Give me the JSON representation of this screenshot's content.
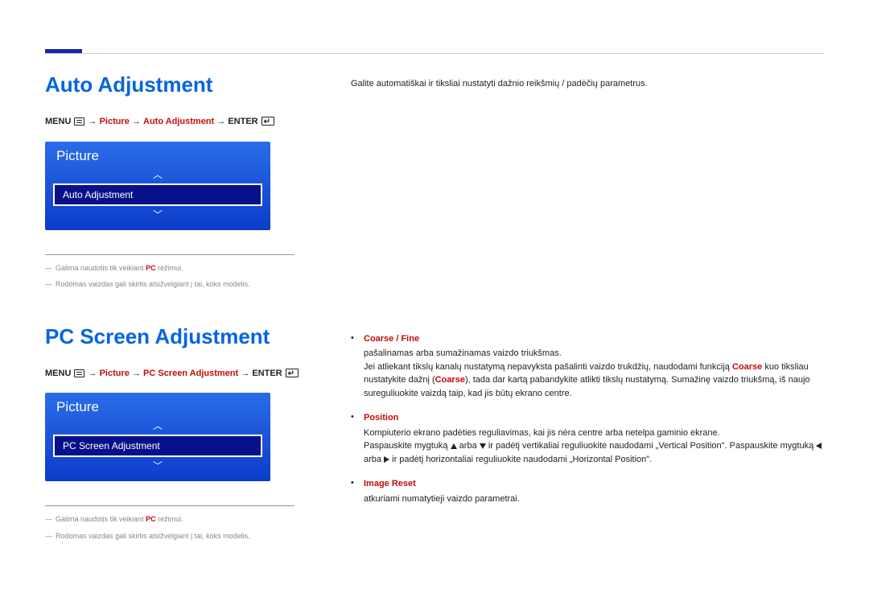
{
  "section1": {
    "title": "Auto Adjustment",
    "path": {
      "menu": "MENU",
      "p1": "Picture",
      "p2": "Auto Adjustment",
      "enter": "ENTER"
    },
    "osd": {
      "title": "Picture",
      "item": "Auto Adjustment"
    },
    "notes": {
      "n1_pre": "Galima naudotis tik veikiant ",
      "n1_hl": "PC",
      "n1_post": " režimui.",
      "n2": "Rodomas vaizdas gali skirtis atsižvelgiant į tai, koks modelis."
    },
    "desc": "Galite automatiškai ir tiksliai nustatyti dažnio reikšmių / padėčių parametrus."
  },
  "section2": {
    "title": "PC Screen Adjustment",
    "path": {
      "menu": "MENU",
      "p1": "Picture",
      "p2": "PC Screen Adjustment",
      "enter": "ENTER"
    },
    "osd": {
      "title": "Picture",
      "item": "PC Screen Adjustment"
    },
    "notes": {
      "n1_pre": "Galima naudotis tik veikiant ",
      "n1_hl": "PC",
      "n1_post": " režimui.",
      "n2": "Rodomas vaizdas gali skirtis atsižvelgiant į tai, koks modelis."
    },
    "bullets": {
      "b1": {
        "title": "Coarse / Fine",
        "l1": "pašalinamas arba sumažinamas vaizdo triukšmas.",
        "l2a": "Jei atliekant tikslų kanalų nustatymą nepavyksta pašalinti vaizdo trukdžių, naudodami funkciją ",
        "l2hl1": "Coarse",
        "l2b": " kuo tiksliau nustatykite dažnį (",
        "l2hl2": "Coarse",
        "l2c": "), tada dar kartą pabandykite atlikti tikslų nustatymą. Sumažinę vaizdo triukšmą, iš naujo sureguliuokite vaizdą taip, kad jis būtų ekrano centre."
      },
      "b2": {
        "title": "Position",
        "l1": "Kompiuterio ekrano padėties reguliavimas, kai jis nėra centre arba netelpa gaminio ekrane.",
        "l2a": "Paspauskite mygtuką ",
        "l2b": " arba ",
        "l2c": " ir padėtį vertikaliai reguliuokite naudodami „Vertical Position\". Paspauskite mygtuką ",
        "l2d": " arba ",
        "l2e": " ir padėtį horizontaliai reguliuokite naudodami „Horizontal Position\"."
      },
      "b3": {
        "title": "Image Reset",
        "l1": "atkuriami numatytieji vaizdo parametrai."
      }
    }
  }
}
